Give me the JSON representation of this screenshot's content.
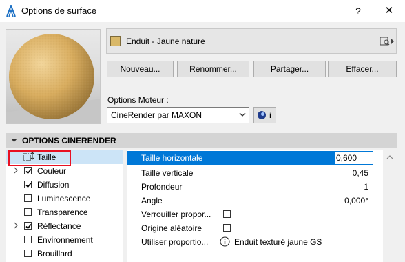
{
  "window": {
    "title": "Options de surface",
    "help_label": "?",
    "close_label": "✕",
    "app_icon": "archicad-logo-icon"
  },
  "material": {
    "name": "Enduit - Jaune nature",
    "swatch_color": "#d9b868"
  },
  "buttons": {
    "new": "Nouveau...",
    "rename": "Renommer...",
    "share": "Partager...",
    "delete": "Effacer..."
  },
  "engine": {
    "label": "Options Moteur :",
    "selected": "CineRender par MAXON",
    "info_label": "i"
  },
  "section": {
    "title": "OPTIONS CINERENDER"
  },
  "channels": [
    {
      "label": "Taille",
      "checked": null,
      "expandable": false,
      "selected": true
    },
    {
      "label": "Couleur",
      "checked": true,
      "expandable": true,
      "selected": false
    },
    {
      "label": "Diffusion",
      "checked": true,
      "expandable": false,
      "selected": false
    },
    {
      "label": "Luminescence",
      "checked": false,
      "expandable": false,
      "selected": false
    },
    {
      "label": "Transparence",
      "checked": false,
      "expandable": false,
      "selected": false
    },
    {
      "label": "Réflectance",
      "checked": true,
      "expandable": true,
      "selected": false
    },
    {
      "label": "Environnement",
      "checked": false,
      "expandable": false,
      "selected": false
    },
    {
      "label": "Brouillard",
      "checked": false,
      "expandable": false,
      "selected": false
    }
  ],
  "properties": [
    {
      "label": "Taille horizontale",
      "value": "0,600",
      "kind": "edit"
    },
    {
      "label": "Taille verticale",
      "value": "0,45",
      "kind": "text"
    },
    {
      "label": "Profondeur",
      "value": "1",
      "kind": "text"
    },
    {
      "label": "Angle",
      "value": "0,000°",
      "kind": "text"
    },
    {
      "label": "Verrouiller propor...",
      "value": "",
      "kind": "checkbox"
    },
    {
      "label": "Origine aléatoire",
      "value": "",
      "kind": "checkbox"
    },
    {
      "label": "Utiliser proportio...",
      "value": "Enduit texturé jaune GS",
      "kind": "info"
    }
  ],
  "colors": {
    "selection_accent": "#0078d7",
    "tree_selection": "#cce4f7",
    "highlight_box": "#e81123"
  }
}
